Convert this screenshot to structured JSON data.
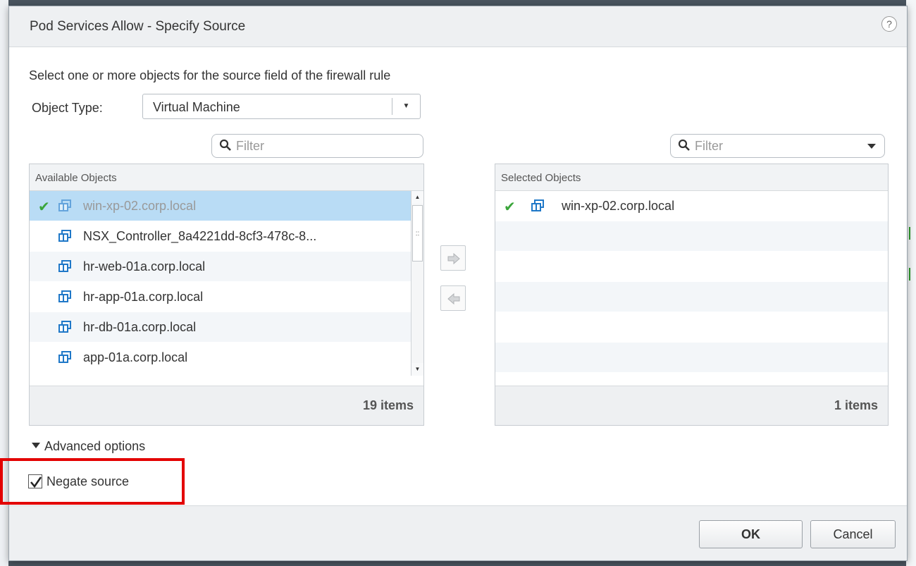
{
  "dialog": {
    "title": "Pod Services Allow - Specify Source",
    "help": "?"
  },
  "instruction": "Select one or more objects for the source field of the firewall rule",
  "object_type": {
    "label": "Object Type:",
    "value": "Virtual Machine"
  },
  "filters": {
    "left_placeholder": "Filter",
    "right_placeholder": "Filter"
  },
  "available": {
    "header": "Available Objects",
    "items": [
      {
        "label": "win-xp-02.corp.local",
        "selected": true
      },
      {
        "label": "NSX_Controller_8a4221dd-8cf3-478c-8...",
        "selected": false
      },
      {
        "label": "hr-web-01a.corp.local",
        "selected": false
      },
      {
        "label": "hr-app-01a.corp.local",
        "selected": false
      },
      {
        "label": "hr-db-01a.corp.local",
        "selected": false
      },
      {
        "label": "app-01a.corp.local",
        "selected": false
      }
    ],
    "count": "19 items"
  },
  "selected": {
    "header": "Selected Objects",
    "items": [
      {
        "label": "win-xp-02.corp.local"
      }
    ],
    "count": "1 items"
  },
  "advanced_options": "Advanced options",
  "negate": {
    "label": "Negate source",
    "checked": true
  },
  "buttons": {
    "ok": "OK",
    "cancel": "Cancel"
  },
  "icons": {
    "check": "check-icon",
    "vm": "virtual-machine-icon",
    "move_right": "arrow-right-icon",
    "move_left": "arrow-left-icon",
    "search": "search-icon"
  },
  "colors": {
    "check": "#3aa53a",
    "selection": "#b9dcf5",
    "highlight": "#e30000",
    "vm_icon": "#1f78c8"
  }
}
